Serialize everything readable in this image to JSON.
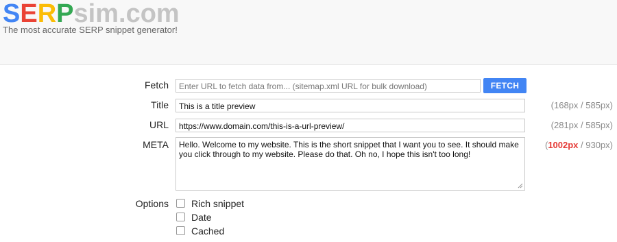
{
  "brand": {
    "logo_s": "S",
    "logo_e": "E",
    "logo_r": "R",
    "logo_p": "P",
    "logo_rest": "sim.com",
    "tagline": "The most accurate SERP snippet generator!",
    "colors": {
      "s": "#4285f4",
      "e": "#ea4335",
      "r": "#fbbc05",
      "p": "#34a853",
      "rest": "#c4c4c4"
    }
  },
  "form": {
    "fetch": {
      "label": "Fetch",
      "placeholder": "Enter URL to fetch data from... (sitemap.xml URL for bulk download)",
      "button": "FETCH",
      "button_color": "#4285f4"
    },
    "title": {
      "label": "Title",
      "value": "This is a title preview",
      "measure": "(168px / 585px)"
    },
    "url": {
      "label": "URL",
      "value": "https://www.domain.com/this-is-a-url-preview/",
      "measure": "(281px / 585px)"
    },
    "meta": {
      "label": "META",
      "value": "Hello. Welcome to my website. This is the short snippet that I want you to see. It should make you click through to my website. Please do that. Oh no, I hope this isn't too long!",
      "measure_open": "(",
      "measure_value": "1002px",
      "measure_rest": " / 930px)",
      "over_color": "#e53935"
    },
    "options": {
      "label": "Options",
      "items": [
        {
          "label": "Rich snippet",
          "checked": false
        },
        {
          "label": "Date",
          "checked": false
        },
        {
          "label": "Cached",
          "checked": false
        }
      ]
    }
  }
}
